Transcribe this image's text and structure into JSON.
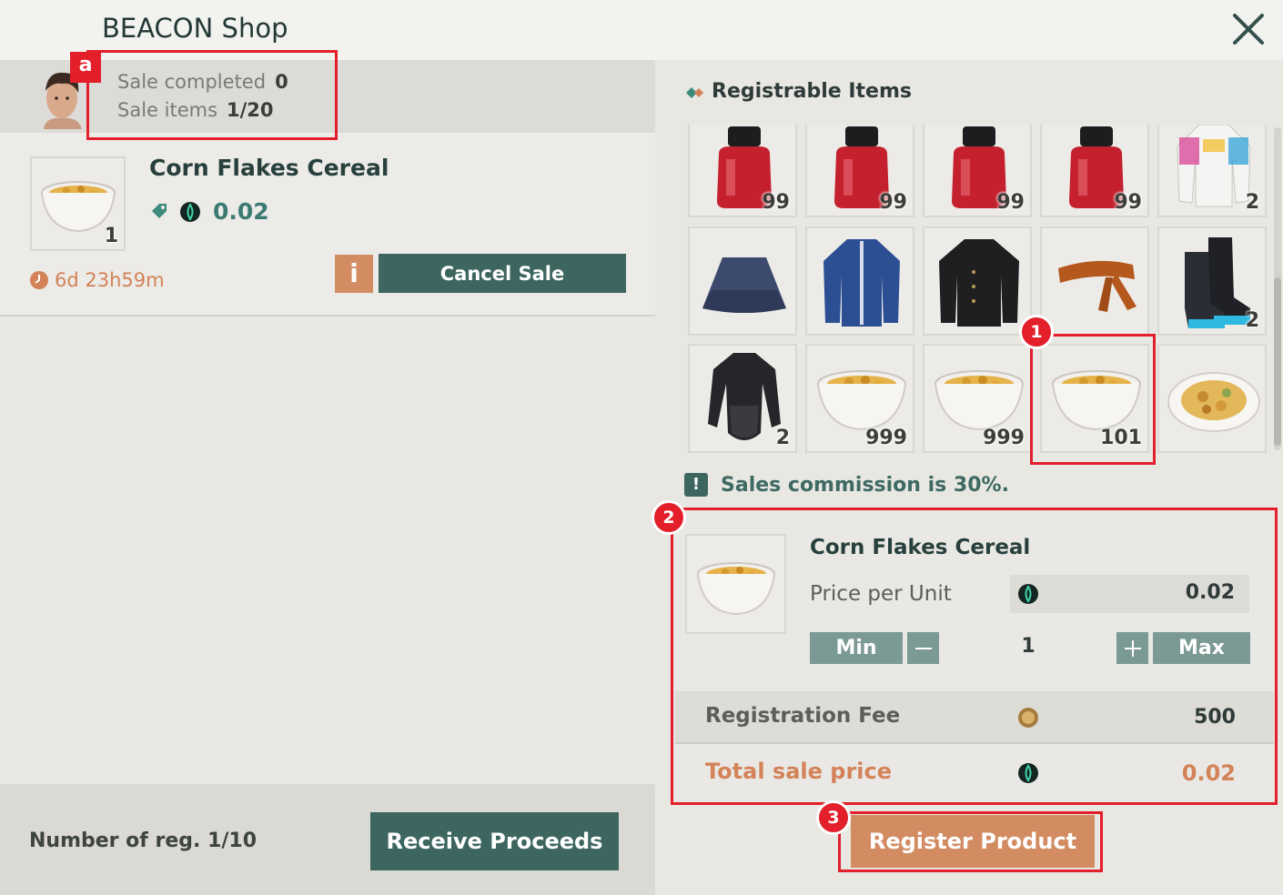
{
  "window": {
    "title": "BEACON Shop"
  },
  "profile": {
    "sale_completed_label": "Sale completed",
    "sale_completed_value": "0",
    "sale_items_label": "Sale items",
    "sale_items_value": "1/20"
  },
  "listing": {
    "item_name": "Corn Flakes Cereal",
    "qty": "1",
    "price": "0.02",
    "timer": "6d 23h59m",
    "info_label": "i",
    "cancel_label": "Cancel Sale"
  },
  "footer": {
    "reg_label": "Number of reg.",
    "reg_value": "1/10",
    "receive_label": "Receive Proceeds"
  },
  "registrable": {
    "title": "Registrable Items",
    "items": [
      {
        "icon": "ink-bottle-icon",
        "qty": "99"
      },
      {
        "icon": "ink-bottle-icon",
        "qty": "99"
      },
      {
        "icon": "ink-bottle-icon",
        "qty": "99"
      },
      {
        "icon": "ink-bottle-icon",
        "qty": "99"
      },
      {
        "icon": "jacket-colorful-icon",
        "qty": "2"
      },
      {
        "icon": "skirt-icon",
        "qty": ""
      },
      {
        "icon": "blue-jacket-icon",
        "qty": ""
      },
      {
        "icon": "black-jacket-icon",
        "qty": ""
      },
      {
        "icon": "headband-icon",
        "qty": ""
      },
      {
        "icon": "boots-icon",
        "qty": "2"
      },
      {
        "icon": "bodysuit-icon",
        "qty": "2"
      },
      {
        "icon": "cereal-bowl-icon",
        "qty": "999"
      },
      {
        "icon": "cereal-bowl-icon",
        "qty": "999"
      },
      {
        "icon": "cereal-bowl-icon",
        "qty": "101"
      },
      {
        "icon": "food-plate-icon",
        "qty": ""
      }
    ]
  },
  "commission": {
    "text": "Sales commission is 30%."
  },
  "register": {
    "item_name": "Corn Flakes Cereal",
    "price_per_unit_label": "Price per Unit",
    "price_per_unit_value": "0.02",
    "min_label": "Min",
    "max_label": "Max",
    "quantity": "1",
    "registration_fee_label": "Registration Fee",
    "registration_fee_value": "500",
    "total_label": "Total sale price",
    "total_value": "0.02",
    "register_button": "Register Product"
  },
  "annotations": {
    "a": "a",
    "one": "1",
    "two": "2",
    "three": "3"
  },
  "colors": {
    "accent_green": "#3e6660",
    "accent_orange": "#d38c62",
    "annotation_red": "#e21f2b"
  }
}
